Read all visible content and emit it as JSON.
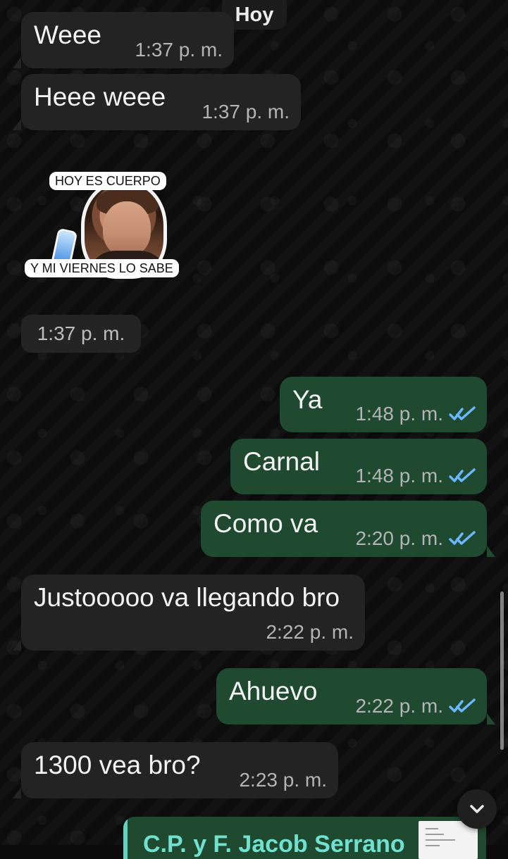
{
  "chat": {
    "day_label": "Hoy",
    "messages": [
      {
        "text": "Weee",
        "time": "1:37 p. m."
      },
      {
        "text": "Heee weee",
        "time": "1:37 p. m."
      },
      {
        "sticker_top": "HOY ES CUERPO",
        "sticker_bottom": "Y MI VIERNES LO SABE",
        "time": "1:37 p. m."
      },
      {
        "text": "Ya",
        "time": "1:48 p. m."
      },
      {
        "text": "Carnal",
        "time": "1:48 p. m."
      },
      {
        "text": "Como va",
        "time": "2:20 p. m."
      },
      {
        "text": "Justooooo va llegando bro",
        "time": "2:22 p. m."
      },
      {
        "text": "Ahuevo",
        "time": "2:22 p. m."
      },
      {
        "text": "1300 vea bro?",
        "time": "2:23 p. m."
      }
    ],
    "partial_title": "C.P. y F. Jacob Serrano"
  },
  "colors": {
    "incoming_bubble": "#232323",
    "outgoing_bubble": "#1f4a2f",
    "read_receipt": "#6ab7ff",
    "background": "#0b0b0b"
  },
  "icons": {
    "read_receipt": "double-check-icon",
    "scroll_down": "chevron-down-icon"
  }
}
